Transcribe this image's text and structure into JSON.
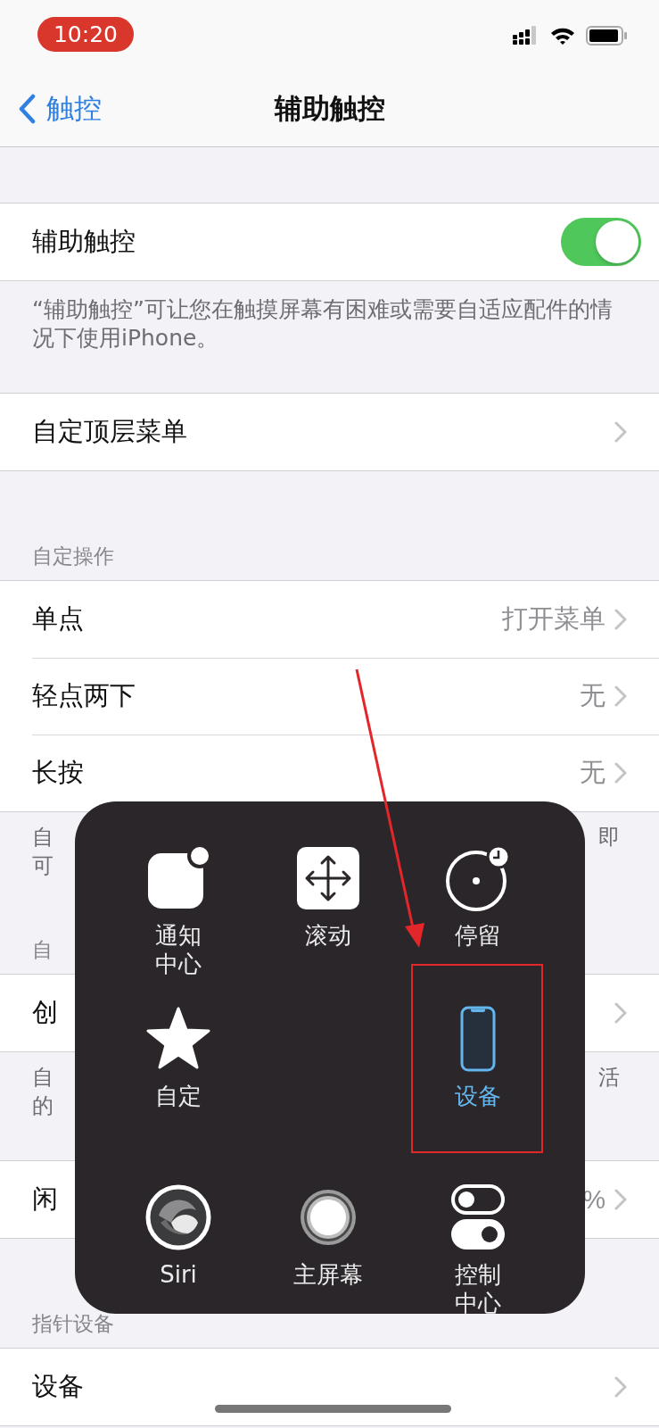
{
  "status_bar": {
    "time": "10:20"
  },
  "nav": {
    "back": "触控",
    "title": "辅助触控"
  },
  "groups": [
    {
      "rows": [
        {
          "kind": "toggle",
          "label": "辅助触控",
          "on": true
        }
      ],
      "footer": {
        "text": "“辅助触控”可让您在触摸屏幕有困难或需要自适应配件的情况下使用iPhone。"
      }
    },
    {
      "rows": [
        {
          "kind": "link",
          "label": "自定顶层菜单"
        }
      ]
    },
    {
      "header": "自定操作",
      "rows": [
        {
          "kind": "link",
          "label": "单点",
          "value": "打开菜单"
        },
        {
          "kind": "link",
          "label": "轻点两下",
          "value": "无"
        },
        {
          "kind": "link",
          "label": "长按",
          "value": "无"
        }
      ],
      "footer": {
        "left_lines": [
          "自",
          "可"
        ],
        "right_lines": [
          "即"
        ]
      }
    },
    {
      "header": "自",
      "rows": [
        {
          "kind": "link",
          "label": "创"
        }
      ],
      "footer": {
        "left_lines": [
          "自",
          "的"
        ],
        "right_lines": [
          "活"
        ]
      }
    },
    {
      "rows": [
        {
          "kind": "link",
          "label": "闲",
          "value": "%"
        }
      ]
    },
    {
      "header": "指针设备",
      "rows": [
        {
          "kind": "link",
          "label": "设备"
        }
      ]
    }
  ],
  "menu": {
    "rows": [
      [
        {
          "kind": "notification",
          "label_lines": [
            "通知",
            "中心"
          ],
          "selected": false
        },
        {
          "kind": "scroll",
          "label_lines": [
            "滚动"
          ],
          "selected": false
        },
        {
          "kind": "dwell",
          "label_lines": [
            "停留"
          ],
          "selected": false
        }
      ],
      [
        {
          "kind": "custom",
          "label_lines": [
            "自定"
          ],
          "selected": false
        },
        null,
        {
          "kind": "device",
          "label_lines": [
            "设备"
          ],
          "selected": true
        }
      ],
      [
        {
          "kind": "siri",
          "label_lines": [
            "Siri"
          ],
          "selected": false
        },
        {
          "kind": "home",
          "label_lines": [
            "主屏幕"
          ],
          "selected": false
        },
        {
          "kind": "control",
          "label_lines": [
            "控制",
            "中心"
          ],
          "selected": false
        }
      ]
    ]
  }
}
